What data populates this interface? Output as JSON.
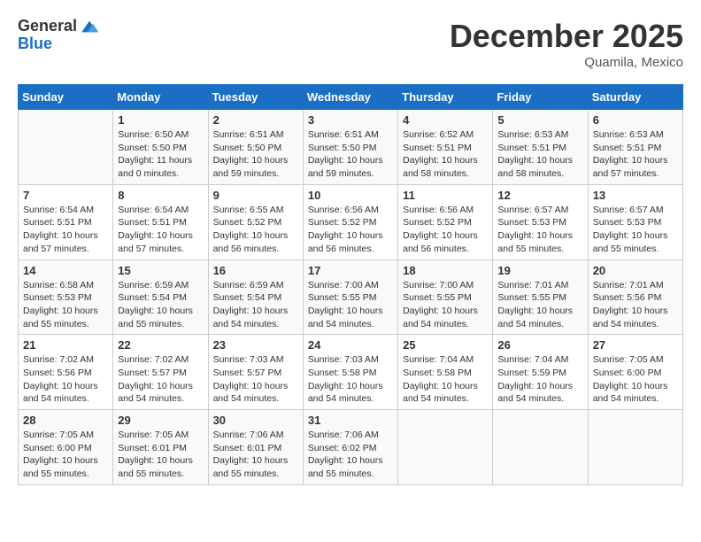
{
  "header": {
    "logo_general": "General",
    "logo_blue": "Blue",
    "month_title": "December 2025",
    "location": "Quamila, Mexico"
  },
  "days_of_week": [
    "Sunday",
    "Monday",
    "Tuesday",
    "Wednesday",
    "Thursday",
    "Friday",
    "Saturday"
  ],
  "weeks": [
    [
      {
        "day": "",
        "sunrise": "",
        "sunset": "",
        "daylight": ""
      },
      {
        "day": "1",
        "sunrise": "Sunrise: 6:50 AM",
        "sunset": "Sunset: 5:50 PM",
        "daylight": "Daylight: 11 hours and 0 minutes."
      },
      {
        "day": "2",
        "sunrise": "Sunrise: 6:51 AM",
        "sunset": "Sunset: 5:50 PM",
        "daylight": "Daylight: 10 hours and 59 minutes."
      },
      {
        "day": "3",
        "sunrise": "Sunrise: 6:51 AM",
        "sunset": "Sunset: 5:50 PM",
        "daylight": "Daylight: 10 hours and 59 minutes."
      },
      {
        "day": "4",
        "sunrise": "Sunrise: 6:52 AM",
        "sunset": "Sunset: 5:51 PM",
        "daylight": "Daylight: 10 hours and 58 minutes."
      },
      {
        "day": "5",
        "sunrise": "Sunrise: 6:53 AM",
        "sunset": "Sunset: 5:51 PM",
        "daylight": "Daylight: 10 hours and 58 minutes."
      },
      {
        "day": "6",
        "sunrise": "Sunrise: 6:53 AM",
        "sunset": "Sunset: 5:51 PM",
        "daylight": "Daylight: 10 hours and 57 minutes."
      }
    ],
    [
      {
        "day": "7",
        "sunrise": "Sunrise: 6:54 AM",
        "sunset": "Sunset: 5:51 PM",
        "daylight": "Daylight: 10 hours and 57 minutes."
      },
      {
        "day": "8",
        "sunrise": "Sunrise: 6:54 AM",
        "sunset": "Sunset: 5:51 PM",
        "daylight": "Daylight: 10 hours and 57 minutes."
      },
      {
        "day": "9",
        "sunrise": "Sunrise: 6:55 AM",
        "sunset": "Sunset: 5:52 PM",
        "daylight": "Daylight: 10 hours and 56 minutes."
      },
      {
        "day": "10",
        "sunrise": "Sunrise: 6:56 AM",
        "sunset": "Sunset: 5:52 PM",
        "daylight": "Daylight: 10 hours and 56 minutes."
      },
      {
        "day": "11",
        "sunrise": "Sunrise: 6:56 AM",
        "sunset": "Sunset: 5:52 PM",
        "daylight": "Daylight: 10 hours and 56 minutes."
      },
      {
        "day": "12",
        "sunrise": "Sunrise: 6:57 AM",
        "sunset": "Sunset: 5:53 PM",
        "daylight": "Daylight: 10 hours and 55 minutes."
      },
      {
        "day": "13",
        "sunrise": "Sunrise: 6:57 AM",
        "sunset": "Sunset: 5:53 PM",
        "daylight": "Daylight: 10 hours and 55 minutes."
      }
    ],
    [
      {
        "day": "14",
        "sunrise": "Sunrise: 6:58 AM",
        "sunset": "Sunset: 5:53 PM",
        "daylight": "Daylight: 10 hours and 55 minutes."
      },
      {
        "day": "15",
        "sunrise": "Sunrise: 6:59 AM",
        "sunset": "Sunset: 5:54 PM",
        "daylight": "Daylight: 10 hours and 55 minutes."
      },
      {
        "day": "16",
        "sunrise": "Sunrise: 6:59 AM",
        "sunset": "Sunset: 5:54 PM",
        "daylight": "Daylight: 10 hours and 54 minutes."
      },
      {
        "day": "17",
        "sunrise": "Sunrise: 7:00 AM",
        "sunset": "Sunset: 5:55 PM",
        "daylight": "Daylight: 10 hours and 54 minutes."
      },
      {
        "day": "18",
        "sunrise": "Sunrise: 7:00 AM",
        "sunset": "Sunset: 5:55 PM",
        "daylight": "Daylight: 10 hours and 54 minutes."
      },
      {
        "day": "19",
        "sunrise": "Sunrise: 7:01 AM",
        "sunset": "Sunset: 5:55 PM",
        "daylight": "Daylight: 10 hours and 54 minutes."
      },
      {
        "day": "20",
        "sunrise": "Sunrise: 7:01 AM",
        "sunset": "Sunset: 5:56 PM",
        "daylight": "Daylight: 10 hours and 54 minutes."
      }
    ],
    [
      {
        "day": "21",
        "sunrise": "Sunrise: 7:02 AM",
        "sunset": "Sunset: 5:56 PM",
        "daylight": "Daylight: 10 hours and 54 minutes."
      },
      {
        "day": "22",
        "sunrise": "Sunrise: 7:02 AM",
        "sunset": "Sunset: 5:57 PM",
        "daylight": "Daylight: 10 hours and 54 minutes."
      },
      {
        "day": "23",
        "sunrise": "Sunrise: 7:03 AM",
        "sunset": "Sunset: 5:57 PM",
        "daylight": "Daylight: 10 hours and 54 minutes."
      },
      {
        "day": "24",
        "sunrise": "Sunrise: 7:03 AM",
        "sunset": "Sunset: 5:58 PM",
        "daylight": "Daylight: 10 hours and 54 minutes."
      },
      {
        "day": "25",
        "sunrise": "Sunrise: 7:04 AM",
        "sunset": "Sunset: 5:58 PM",
        "daylight": "Daylight: 10 hours and 54 minutes."
      },
      {
        "day": "26",
        "sunrise": "Sunrise: 7:04 AM",
        "sunset": "Sunset: 5:59 PM",
        "daylight": "Daylight: 10 hours and 54 minutes."
      },
      {
        "day": "27",
        "sunrise": "Sunrise: 7:05 AM",
        "sunset": "Sunset: 6:00 PM",
        "daylight": "Daylight: 10 hours and 54 minutes."
      }
    ],
    [
      {
        "day": "28",
        "sunrise": "Sunrise: 7:05 AM",
        "sunset": "Sunset: 6:00 PM",
        "daylight": "Daylight: 10 hours and 55 minutes."
      },
      {
        "day": "29",
        "sunrise": "Sunrise: 7:05 AM",
        "sunset": "Sunset: 6:01 PM",
        "daylight": "Daylight: 10 hours and 55 minutes."
      },
      {
        "day": "30",
        "sunrise": "Sunrise: 7:06 AM",
        "sunset": "Sunset: 6:01 PM",
        "daylight": "Daylight: 10 hours and 55 minutes."
      },
      {
        "day": "31",
        "sunrise": "Sunrise: 7:06 AM",
        "sunset": "Sunset: 6:02 PM",
        "daylight": "Daylight: 10 hours and 55 minutes."
      },
      {
        "day": "",
        "sunrise": "",
        "sunset": "",
        "daylight": ""
      },
      {
        "day": "",
        "sunrise": "",
        "sunset": "",
        "daylight": ""
      },
      {
        "day": "",
        "sunrise": "",
        "sunset": "",
        "daylight": ""
      }
    ]
  ]
}
